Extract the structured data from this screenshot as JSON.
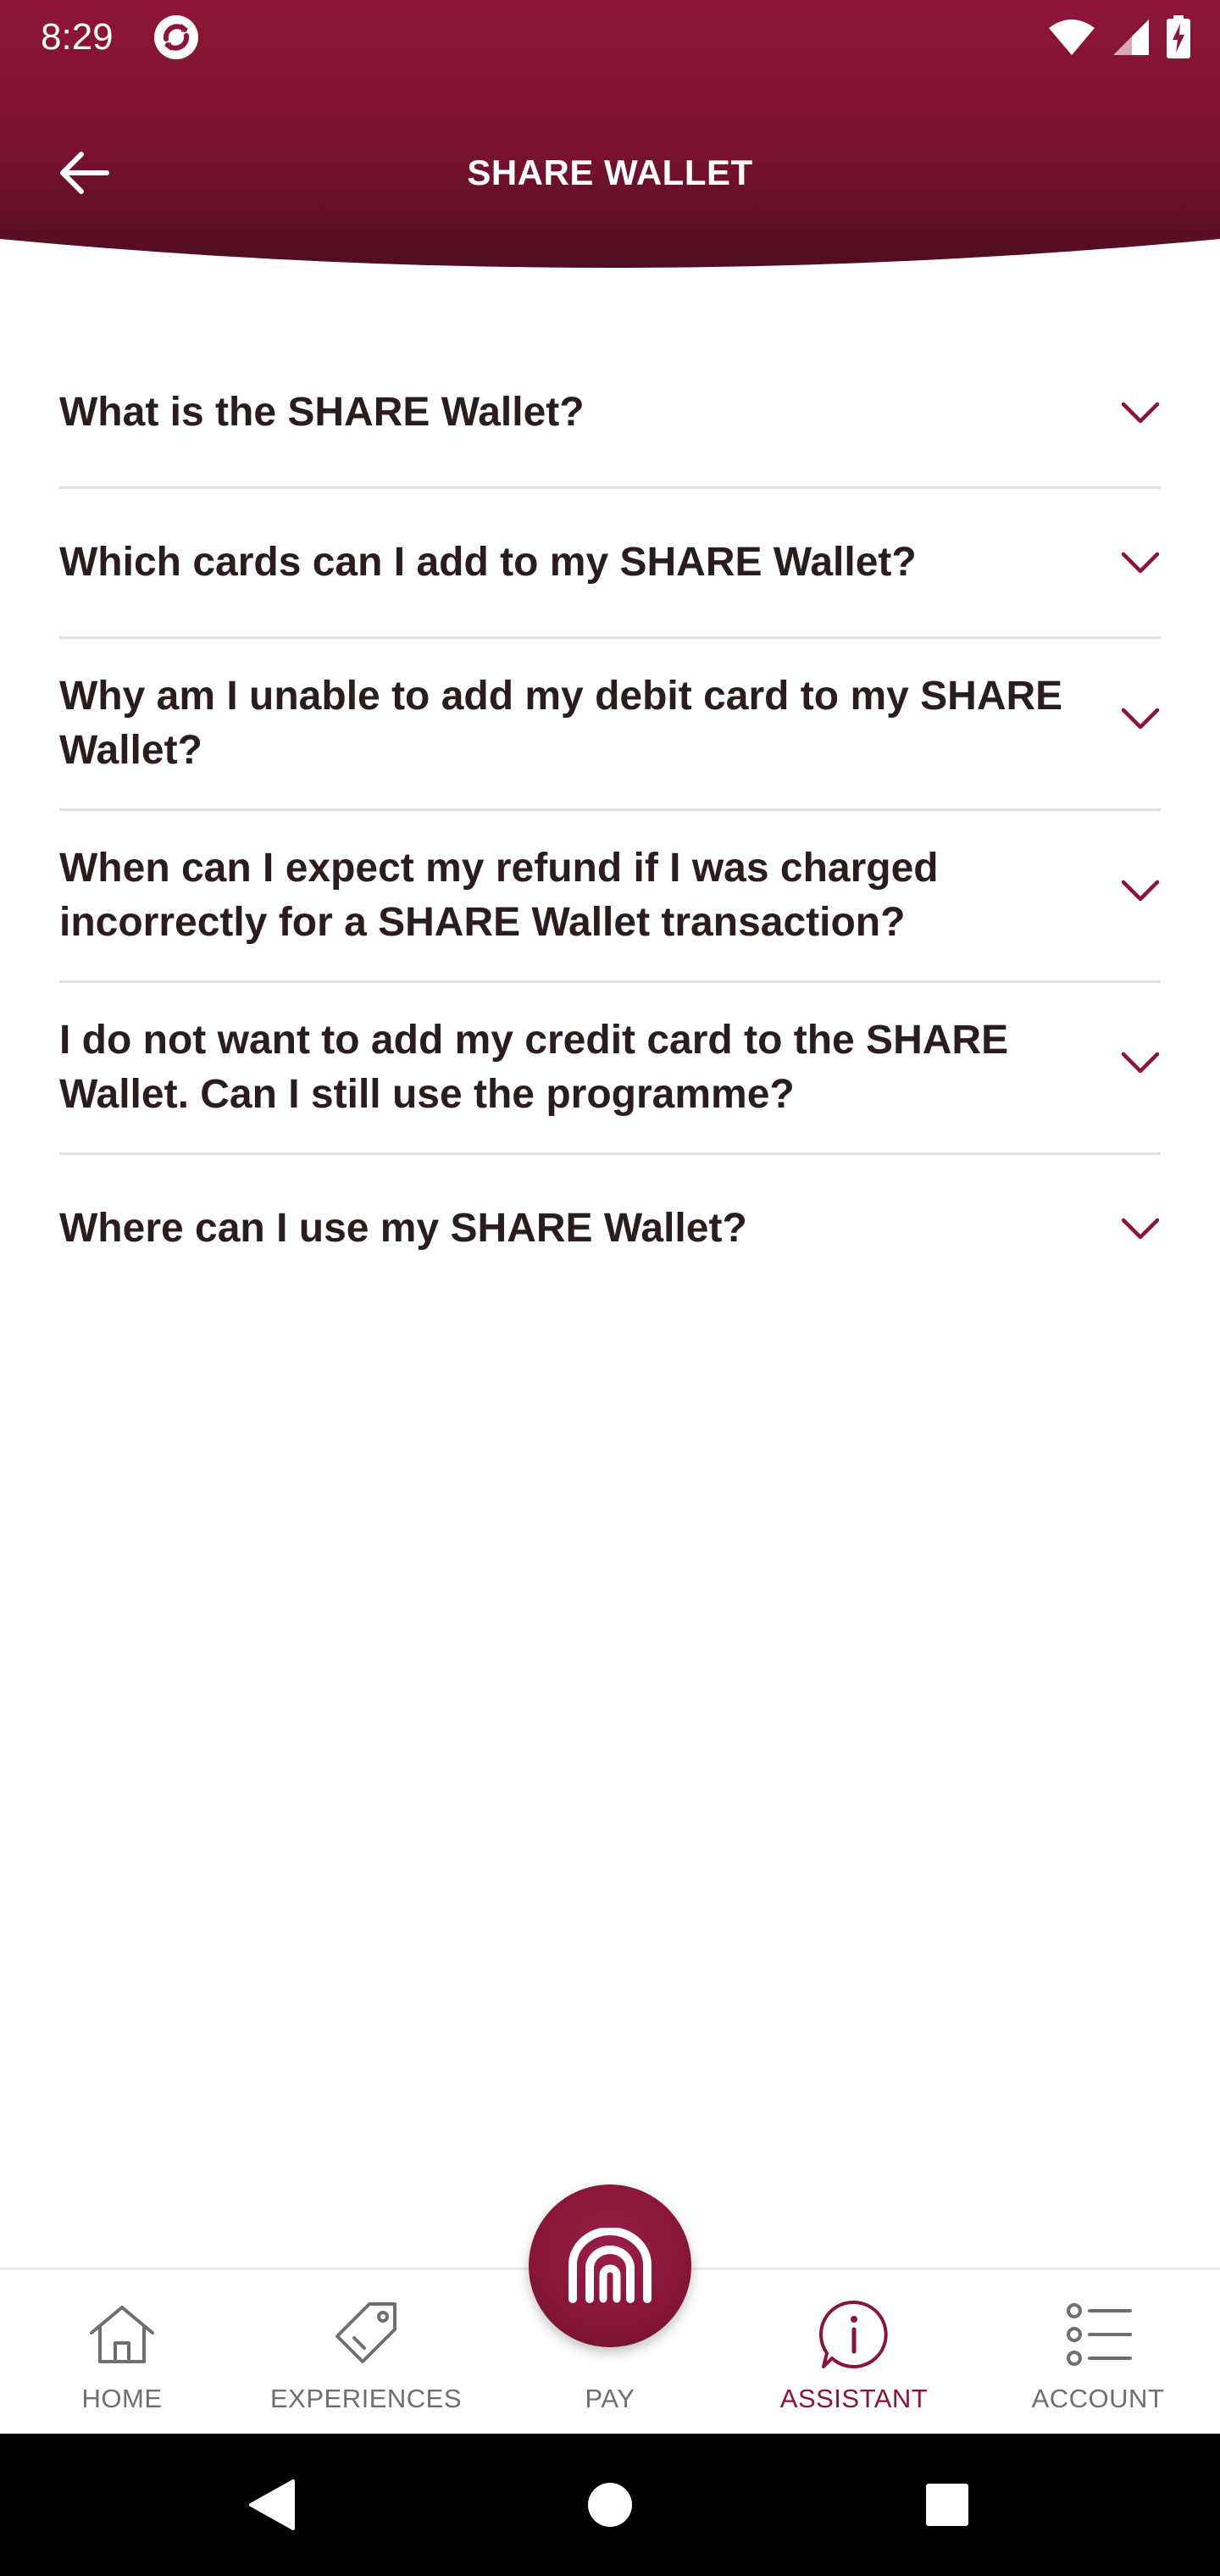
{
  "status_bar": {
    "time": "8:29",
    "app_icon": "sync-app-icon",
    "right_icons": [
      "wifi-icon",
      "signal-icon",
      "battery-charging-icon"
    ]
  },
  "header": {
    "title": "SHARE WALLET",
    "back_icon": "arrow-left-icon",
    "background_color_top": "#8e1538",
    "background_color_bottom": "#4f0d20"
  },
  "faq": {
    "items": [
      {
        "question": "What is the SHARE Wallet?"
      },
      {
        "question": "Which cards can I add to my SHARE Wallet?"
      },
      {
        "question": "Why am I unable to add my debit card to my SHARE Wallet?"
      },
      {
        "question": "When can I expect my refund if I was charged incorrectly for a SHARE Wallet transaction?"
      },
      {
        "question": "I do not want to add my credit card to the SHARE Wallet. Can I still use the programme?"
      },
      {
        "question": "Where can I use my SHARE Wallet?"
      }
    ],
    "chevron_icon": "chevron-down-icon",
    "accent_color": "#8a1538"
  },
  "bottom_nav": {
    "items": [
      {
        "label": "HOME",
        "icon": "home-icon",
        "active": false
      },
      {
        "label": "EXPERIENCES",
        "icon": "tag-icon",
        "active": false
      },
      {
        "label": "PAY",
        "icon": "pay-logo-icon",
        "active": false
      },
      {
        "label": "ASSISTANT",
        "icon": "info-chat-icon",
        "active": true
      },
      {
        "label": "ACCOUNT",
        "icon": "list-icon",
        "active": false
      }
    ],
    "active_color": "#8a1538",
    "inactive_color": "#6f6f6f"
  },
  "system_nav": {
    "buttons": [
      "back-triangle-icon",
      "home-circle-icon",
      "recents-square-icon"
    ]
  }
}
